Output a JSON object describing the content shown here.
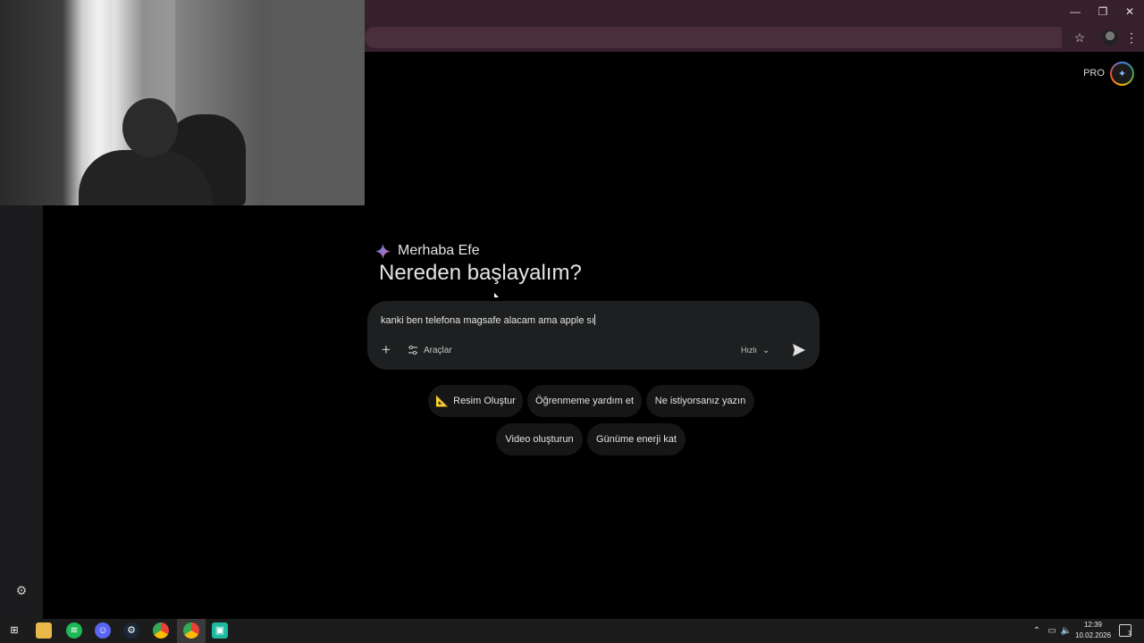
{
  "browser": {
    "window_controls": {
      "minimize": "—",
      "maximize": "❐",
      "close": "✕"
    },
    "toolbar_icons": [
      "star-icon",
      "profile-avatar-icon",
      "more-vert-icon"
    ]
  },
  "header": {
    "plan_badge": "PRO"
  },
  "main": {
    "greeting": "Merhaba Efe",
    "headline": "Nereden başlayalım?",
    "composer": {
      "input_value": "kanki ben telefona magsafe alacam ama apple sı",
      "tools_label": "Araçlar",
      "mode_label": "Hızlı"
    },
    "chips": [
      {
        "emoji": "📐",
        "label": "Resim Oluştur"
      },
      {
        "label": "Öğrenmeme yardım et"
      },
      {
        "label": "Ne istiyorsanız yazın"
      },
      {
        "label": "Video oluşturun"
      },
      {
        "label": "Günüme enerji kat"
      }
    ]
  },
  "taskbar": {
    "apps": [
      "windows-start-icon",
      "file-explorer-icon",
      "spotify-icon",
      "discord-icon",
      "steam-icon",
      "chrome-icon",
      "chrome-profile-icon",
      "app-icon"
    ],
    "clock": {
      "time": "12:39",
      "date": "10.02.2026"
    },
    "notification_count": "1"
  },
  "colors": {
    "browser_frame": "#35202c",
    "page_bg": "#000000",
    "composer_bg": "#1e1f20",
    "chip_bg": "#161616",
    "taskbar_bg": "#1c1c1c"
  }
}
